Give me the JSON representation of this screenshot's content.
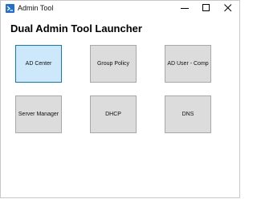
{
  "window": {
    "title": "Admin Tool"
  },
  "controls": {
    "minimize_icon": "minimize-icon",
    "maximize_icon": "maximize-icon",
    "close_icon": "close-icon"
  },
  "main": {
    "heading": "Dual Admin Tool Launcher",
    "tiles": [
      {
        "label": "AD Center",
        "highlighted": true
      },
      {
        "label": "Group Policy",
        "highlighted": false
      },
      {
        "label": "AD User - Comp",
        "highlighted": false
      },
      {
        "label": "Server Manager",
        "highlighted": false
      },
      {
        "label": "DHCP",
        "highlighted": false
      },
      {
        "label": "DNS",
        "highlighted": false
      }
    ]
  },
  "colors": {
    "tile_background": "#dcdcdc",
    "tile_highlight_background": "#cde8fa",
    "tile_highlight_border": "#0f78d7",
    "app_icon": "#1f6fd1"
  }
}
